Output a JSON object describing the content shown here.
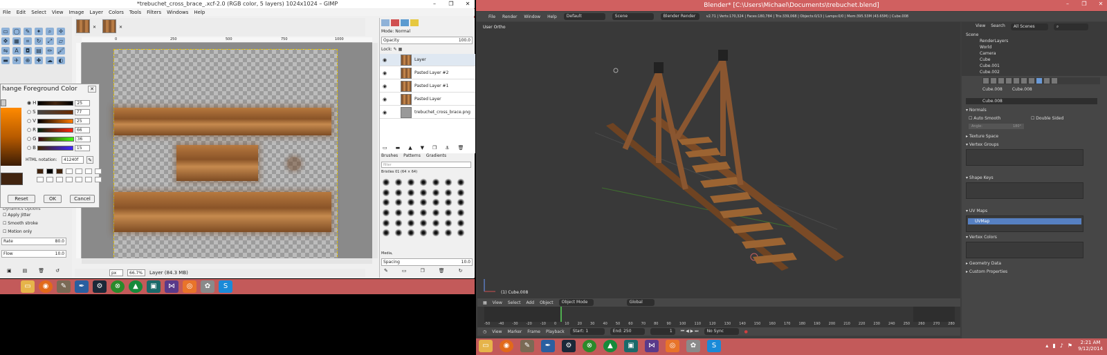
{
  "gimp": {
    "title": "*trebuchet_cross_brace_.xcf-2.0 (RGB color, 5 layers) 1024x1024 – GIMP",
    "menu": [
      "File",
      "Edit",
      "Select",
      "View",
      "Image",
      "Layer",
      "Colors",
      "Tools",
      "Filters",
      "Windows",
      "Help"
    ],
    "ruler_marks": [
      "0",
      "250",
      "500",
      "750",
      "1000"
    ],
    "unit": "px",
    "zoom": "66.7%",
    "status": "Layer (84.3 MB)",
    "tool_options": {
      "apply_jitter": "Apply Jitter",
      "smooth_stroke": "Smooth stroke",
      "motion_only": "Motion only",
      "dynamics_options": "Dynamics Options",
      "rate_label": "Rate",
      "rate_value": "80.0",
      "flow_label": "Flow",
      "flow_value": "10.0"
    },
    "dialog": {
      "title": "hange Foreground Color",
      "channels": [
        {
          "label": "H",
          "value": "25"
        },
        {
          "label": "S",
          "value": "77"
        },
        {
          "label": "V",
          "value": "25"
        },
        {
          "label": "R",
          "value": "66"
        },
        {
          "label": "G",
          "value": "36"
        },
        {
          "label": "B",
          "value": "15"
        }
      ],
      "html_label": "HTML notation:",
      "html_value": "41240f",
      "reset": "Reset",
      "ok": "OK",
      "cancel": "Cancel",
      "color_hex": "#41240f"
    },
    "layers": {
      "mode_label": "Mode:",
      "mode_value": "Normal",
      "opacity_label": "Opacity",
      "opacity_value": "100.0",
      "lock_label": "Lock:",
      "items": [
        "Layer",
        "Pasted Layer #2",
        "Pasted Layer #1",
        "Pasted Layer",
        "trebuchet_cross_brace.png"
      ]
    },
    "brushes": {
      "tabs": [
        "Brushes",
        "Patterns",
        "Gradients"
      ],
      "filter": "filter",
      "selected": "Bristles 01 (64 × 64)",
      "category": "Media,",
      "spacing_label": "Spacing",
      "spacing_value": "10.0"
    }
  },
  "blender": {
    "title": "Blender* [C:\\Users\\Michael\\Documents\\trebuchet.blend]",
    "menu": [
      "File",
      "Render",
      "Window",
      "Help"
    ],
    "layout": "Default",
    "scene": "Scene",
    "engine": "Blender Render",
    "stats": "v2.71 | Verts:170,324 | Faces:180,784 | Tris:339,068 | Objects:0/13 | Lamps:0/0 | Mem:395.53M (43.65M) | Cube.008",
    "view_label": "User Ortho",
    "object_label": "(1) Cube.008",
    "vp_menu": [
      "View",
      "Select",
      "Add",
      "Object"
    ],
    "mode": "Object Mode",
    "orientation": "Global",
    "timeline_ticks": [
      "-50",
      "-40",
      "-30",
      "-20",
      "-10",
      "0",
      "10",
      "20",
      "30",
      "40",
      "50",
      "60",
      "70",
      "80",
      "90",
      "100",
      "110",
      "120",
      "130",
      "140",
      "150",
      "160",
      "170",
      "180",
      "190",
      "200",
      "210",
      "220",
      "230",
      "240",
      "250",
      "260",
      "270",
      "280"
    ],
    "tl_menu": [
      "View",
      "Marker",
      "Frame",
      "Playback"
    ],
    "start": "Start: 1",
    "end": "End: 250",
    "current": "1",
    "sync": "No Sync",
    "outliner": {
      "view": "View",
      "search": "Search",
      "scenes": "All Scenes",
      "items": [
        "Scene",
        "RenderLayers",
        "World",
        "Camera",
        "Cube",
        "Cube.001",
        "Cube.002"
      ]
    },
    "properties": {
      "breadcrumb_obj": "Cube.008",
      "breadcrumb_mesh": "Cube.008",
      "mesh_name": "Cube.008",
      "normals": "Normals",
      "auto_smooth": "Auto Smooth",
      "double_sided": "Double Sided",
      "angle": "Angle:",
      "angle_value": "180°",
      "texture_space": "Texture Space",
      "vertex_groups": "Vertex Groups",
      "shape_keys": "Shape Keys",
      "uv_maps": "UV Maps",
      "uv_item": "UVMap",
      "vertex_colors": "Vertex Colors",
      "geometry_data": "Geometry Data",
      "custom_properties": "Custom Properties"
    }
  },
  "taskbar": {
    "time": "2:21 AM",
    "date": "9/12/2014"
  }
}
